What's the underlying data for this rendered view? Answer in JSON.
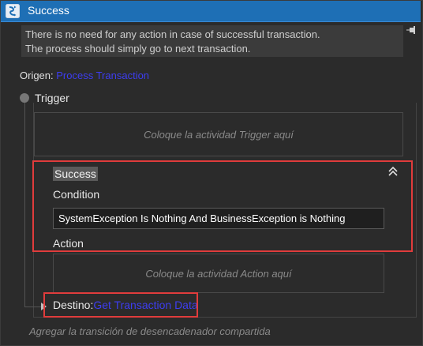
{
  "window": {
    "title": "Success",
    "icon": "state-transition-icon"
  },
  "annotation": {
    "line1": "There is no need for any action in case of successful transaction.",
    "line2": "The process should simply go to next transaction.",
    "pin_icon": "pin-icon"
  },
  "origen": {
    "label": "Origen:",
    "value": "Process Transaction"
  },
  "trigger": {
    "label": "Trigger",
    "drop_placeholder": "Coloque la actividad Trigger aquí"
  },
  "transition": {
    "name": "Success",
    "collapse_icon": "double-chevron-up-icon",
    "condition_label": "Condition",
    "condition_value": "SystemException Is Nothing And BusinessException is Nothing",
    "action_label": "Action",
    "action_placeholder": "Coloque la actividad Action aquí"
  },
  "destino": {
    "label": "Destino:",
    "value": "Get Transaction Data"
  },
  "footer": {
    "shared_transition": "Agregar la transición de desencadenador compartida"
  },
  "colors": {
    "titlebar": "#1e6fb5",
    "link": "#3d3df0",
    "highlight": "#e03c3c",
    "background": "#252526"
  }
}
